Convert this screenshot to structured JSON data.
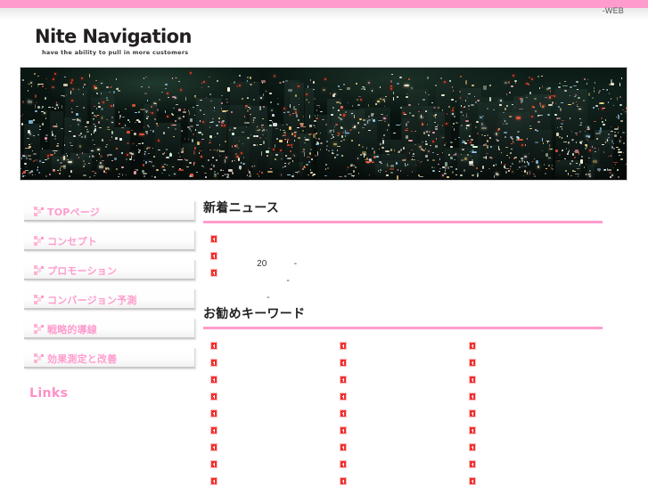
{
  "header": {
    "web_label": "-WEB",
    "logo_title": "Nite Navigation",
    "logo_tagline": "have the ability to pull in more customers"
  },
  "banner": {
    "name": "night-cityscape-banner",
    "alt": "night city skyline"
  },
  "sidebar": {
    "items": [
      {
        "label": "TOPページ",
        "name": "sidebar-item-top-page"
      },
      {
        "label": "コンセプト",
        "name": "sidebar-item-concept"
      },
      {
        "label": "プロモーション",
        "name": "sidebar-item-promotion"
      },
      {
        "label": "コンバージョン予測",
        "name": "sidebar-item-conversion-forecast"
      },
      {
        "label": "戦略的導線",
        "name": "sidebar-item-strategic-flow"
      },
      {
        "label": "効果測定と改善",
        "name": "sidebar-item-measurement-improvement"
      }
    ],
    "links_heading": "Links"
  },
  "main": {
    "news": {
      "title": "新着ニュース",
      "items": [
        "     20           -",
        "                 -",
        "         -"
      ]
    },
    "keywords": {
      "title": "お勧めキーワード",
      "columns": [
        [
          "",
          "",
          "",
          "",
          "",
          "",
          "",
          "",
          ""
        ],
        [
          "",
          "",
          "",
          "",
          "",
          "",
          "",
          "",
          ""
        ],
        [
          "",
          "",
          "",
          "",
          "",
          "",
          "",
          "",
          ""
        ]
      ]
    }
  },
  "colors": {
    "accent_pink": "#ff9ccd",
    "link_pink": "#ff8fc6",
    "bullet_red": "#f23030",
    "text_dark": "#222222"
  }
}
